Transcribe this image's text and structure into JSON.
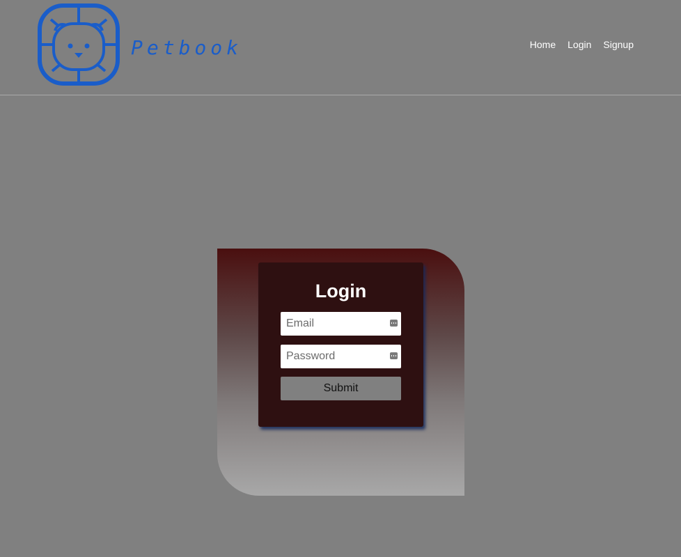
{
  "header": {
    "brand": "Petbook",
    "nav": [
      "Home",
      "Login",
      "Signup"
    ]
  },
  "login": {
    "title": "Login",
    "email_placeholder": "Email",
    "password_placeholder": "Password",
    "submit_label": "Submit"
  },
  "colors": {
    "page_bg": "#808080",
    "brand_blue": "#1a5dc9",
    "card_bg": "#2e1011"
  },
  "icons": {
    "logo": "lion-face-logo",
    "field_icon": "password-manager-icon"
  }
}
